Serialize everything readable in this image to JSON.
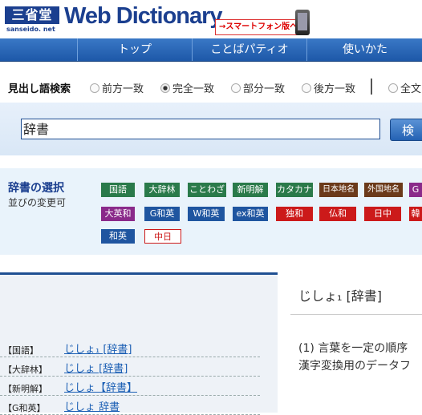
{
  "header": {
    "logo_text": "三省堂",
    "logo_sub": "sanseido. net",
    "title": "Web Dictionary",
    "smartphone_link": "→スマートフォン版へ"
  },
  "nav": {
    "items": [
      "トップ",
      "ことばパティオ",
      "使いかた"
    ]
  },
  "search": {
    "label": "見出し語検索",
    "options": [
      "前方一致",
      "完全一致",
      "部分一致",
      "後方一致",
      "全文"
    ],
    "selected": "完全一致",
    "input_value": "辞書",
    "button_label": "検"
  },
  "dictionaries": {
    "title": "辞書の選択",
    "subtitle": "並びの変更可",
    "row1": [
      {
        "label": "国語",
        "color": "#2a7a4a"
      },
      {
        "label": "大辞林",
        "color": "#2a7a4a"
      },
      {
        "label": "ことわざ",
        "color": "#2a7a4a"
      },
      {
        "label": "新明解",
        "color": "#2a7a4a"
      },
      {
        "label": "カタカナ",
        "color": "#2a7a4a"
      },
      {
        "label": "日本地名",
        "color": "#6b3a1a"
      },
      {
        "label": "外国地名",
        "color": "#6b3a1a"
      },
      {
        "label": "G",
        "color": "#8a2a8a"
      }
    ],
    "row2": [
      {
        "label": "大英和",
        "color": "#8a2a8a"
      },
      {
        "label": "G和英",
        "color": "#1f55a0"
      },
      {
        "label": "W和英",
        "color": "#1f55a0"
      },
      {
        "label": "ex和英",
        "color": "#1f55a0"
      },
      {
        "label": "独和",
        "color": "#cc1a1a"
      },
      {
        "label": "仏和",
        "color": "#cc1a1a"
      },
      {
        "label": "日中",
        "color": "#cc1a1a"
      },
      {
        "label": "韓",
        "color": "#cc1a1a"
      }
    ],
    "row3": [
      {
        "label": "和英",
        "color": "#1f55a0"
      },
      {
        "label": "中日",
        "color": "#ffffff"
      }
    ]
  },
  "results": [
    {
      "label": "【国語】",
      "link": "じしょ₁ [辞書]"
    },
    {
      "label": "【大辞林】",
      "link": "じしょ [辞書]"
    },
    {
      "label": "【新明解】",
      "link": "じしょ【辞書】"
    },
    {
      "label": "【G和英】",
      "link": "じしょ 辞書"
    }
  ],
  "entry": {
    "heading": "じしょ₁ [辞書]",
    "definition_line1": "(1) 言葉を一定の順序",
    "definition_line2": "漢字変換用のデータフ"
  }
}
